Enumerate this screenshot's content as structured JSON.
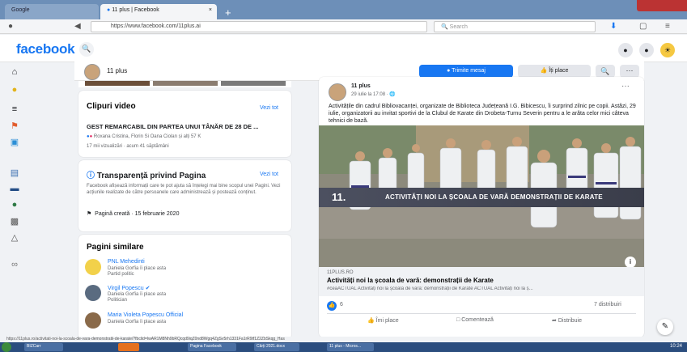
{
  "browser": {
    "tabs": [
      {
        "label": "Google"
      },
      {
        "label": "11 plus | Facebook"
      }
    ],
    "new_tab": "+",
    "address": "https://www.facebook.com/11plus.ai",
    "search_placeholder": "Search"
  },
  "fb": {
    "logo": "facebook"
  },
  "page": {
    "name": "11 plus",
    "send_message": "Trimite mesaj",
    "like": "Îți place",
    "more": "···"
  },
  "video_card": {
    "title": "Clipuri video",
    "see_all": "Vezi tot",
    "headline": "GEST REMARCABIL DIN PARTEA UNUI TÂNĂR DE 28 DE ...",
    "reactions": "Roxana Cristina, Florin Si Oana Ciolan și alți 57 K",
    "meta": "17 mii vizualizări · acum 41 săptămâni"
  },
  "transparency_card": {
    "title": "Transparență privind Pagina",
    "see_all": "Vezi tot",
    "body": "Facebook afișează informații care te pot ajuta să înțelegi mai bine scopul unei Pagini. Vezi acțiunile realizate de către persoanele care administrează și postează conținut.",
    "created": "Pagină creată · 15 februarie 2020"
  },
  "similar_card": {
    "title": "Pagini similare",
    "items": [
      {
        "name": "PNL Mehedinti",
        "sub1": "Daniela Gorfia îi place asta",
        "sub2": "Partid politic"
      },
      {
        "name": "Virgil Popescu",
        "sub1": "Daniela Gorfia îi place asta",
        "sub2": "Politician"
      },
      {
        "name": "Maria Violeta Popescu Official",
        "sub1": "Daniela Gorfia îi place asta",
        "sub2": ""
      }
    ]
  },
  "post": {
    "author": "11 plus",
    "time": "29 iulie la 17:08 · ",
    "more": "···",
    "text": "Activitățile din cadrul Bibliovacanței, organizate de Biblioteca Județeană I.G. Bibicescu, îi surprind zilnic pe copii. Astăzi, 29 iulie, organizatorii au invitat sportivi de la Clubul de Karate din Drobeta-Turnu Severin pentru a le arăta celor mici câteva tehnici de bază.",
    "image_banner": "ACTIVITĂȚI NOI LA ȘCOALA DE VARĂ  DEMONSTRAȚII DE KARATE",
    "link_domain": "11PLUS.RO",
    "link_title": "Activități noi la școala de vară: demonstrații de Karate",
    "link_desc": "#ceaACTUAL Activități noi la școala de vară: demonstrații de Karate ACTUAL Activități noi la ș...",
    "reaction_count": "6",
    "shares": "7 distribuiri",
    "actions": {
      "like": "Îmi place",
      "comment": "Comentează",
      "share": "Distribuie"
    }
  },
  "status_url": "https://11plus.ro/activitati-noi-la-scoala-de-vara-demonstratii-de-karate/?fbclid=IwAR1M8Nh9bRQcqd9iqZ0nd8Wgq4ZgSv5rh1331Fa1rR9tf1Z2ZbSkqg_Has",
  "taskbar": {
    "items": [
      "BIZCarr",
      "",
      "Pagina Facebook",
      "Cărți 2021.docx",
      "11 plus - Micros..."
    ],
    "clock": "10:24"
  },
  "colors": {
    "brand": "#1877f2"
  }
}
